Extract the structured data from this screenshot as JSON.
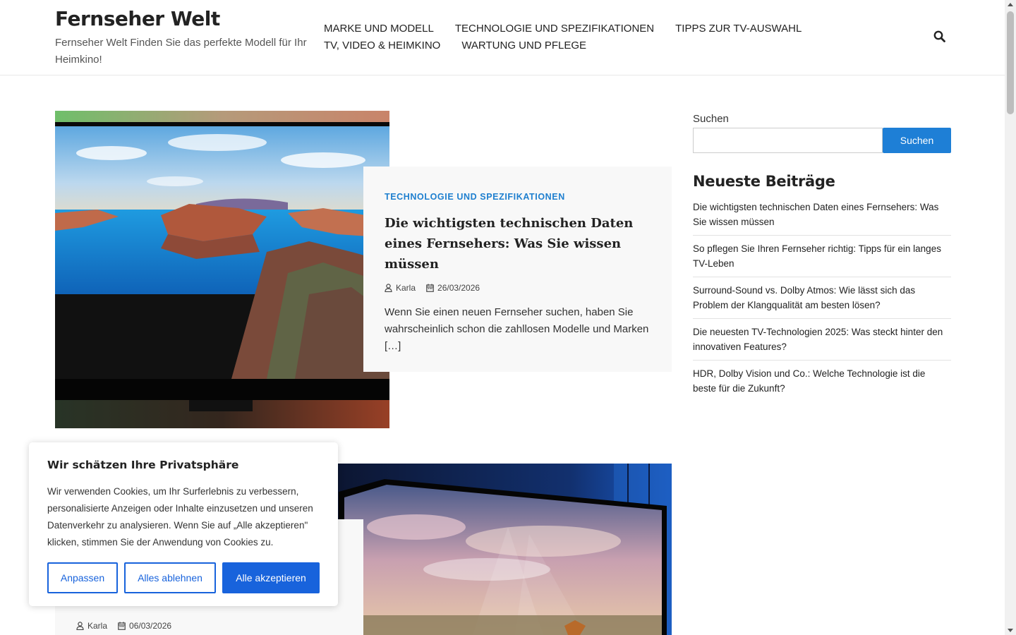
{
  "site": {
    "title": "Fernseher Welt",
    "description": "Fernseher Welt Finden Sie das perfekte Modell für Ihr Heimkino!"
  },
  "nav": {
    "items": [
      "MARKE UND MODELL",
      "TECHNOLOGIE UND SPEZIFIKATIONEN",
      "TIPPS ZUR TV-AUSWAHL",
      "TV, VIDEO & HEIMKINO",
      "WARTUNG UND PFLEGE"
    ],
    "search_icon": "search-icon"
  },
  "posts": [
    {
      "category": "TECHNOLOGIE UND SPEZIFIKATIONEN",
      "title": "Die wichtigsten technischen Daten eines Fernsehers: Was Sie wissen müssen",
      "author": "Karla",
      "date": "26/03/2026",
      "excerpt": "Wenn Sie einen neuen Fernseher suchen, haben Sie wahrscheinlich schon die zahllosen Modelle und Marken […]"
    },
    {
      "author": "Karla",
      "date": "06/03/2026"
    }
  ],
  "sidebar": {
    "search_label": "Suchen",
    "search_button": "Suchen",
    "recent_title": "Neueste Beiträge",
    "recent_posts": [
      "Die wichtigsten technischen Daten eines Fernsehers: Was Sie wissen müssen",
      "So pflegen Sie Ihren Fernseher richtig: Tipps für ein langes TV-Leben",
      "Surround-Sound vs. Dolby Atmos: Wie lässt sich das Problem der Klangqualität am besten lösen?",
      "Die neuesten TV-Technologien 2025: Was steckt hinter den innovativen Features?",
      "HDR, Dolby Vision und Co.: Welche Technologie ist die beste für die Zukunft?"
    ]
  },
  "cookie": {
    "title": "Wir schätzen Ihre Privatsphäre",
    "text": "Wir verwenden Cookies, um Ihr Surferlebnis zu verbessern, personalisierte Anzeigen oder Inhalte einzusetzen und unseren Datenverkehr zu analysieren. Wenn Sie auf „Alle akzeptieren\" klicken, stimmen Sie der Anwendung von Cookies zu.",
    "customize": "Anpassen",
    "reject": "Alles ablehnen",
    "accept": "Alle akzeptieren"
  },
  "colors": {
    "accent": "#1e7fd6",
    "cookie_accent": "#1863dc",
    "category": "#1e7fcf"
  }
}
